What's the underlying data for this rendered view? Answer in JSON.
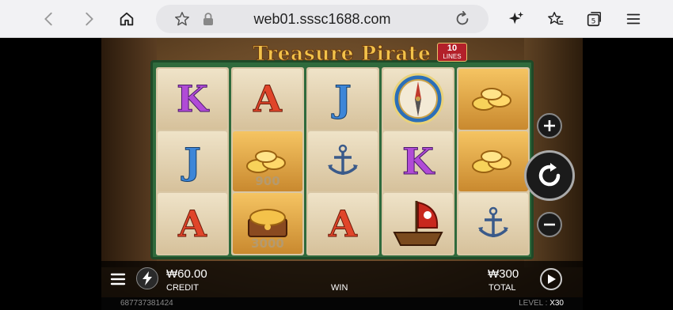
{
  "browser": {
    "url": "web01.sssc1688.com",
    "tab_count": "5"
  },
  "game": {
    "title": "Treasure Pirate",
    "lines_number": "10",
    "lines_label": "LINES",
    "reels": [
      [
        {
          "symbol": "K",
          "type": "letter"
        },
        {
          "symbol": "J",
          "type": "letter"
        },
        {
          "symbol": "A",
          "type": "letter"
        }
      ],
      [
        {
          "symbol": "A",
          "type": "letter"
        },
        {
          "symbol": "gold-coins",
          "type": "gold",
          "value": "900"
        },
        {
          "symbol": "treasure-chest",
          "type": "gold",
          "value": "3000"
        }
      ],
      [
        {
          "symbol": "J",
          "type": "letter"
        },
        {
          "symbol": "anchor",
          "type": "icon"
        },
        {
          "symbol": "A",
          "type": "letter"
        }
      ],
      [
        {
          "symbol": "compass",
          "type": "icon"
        },
        {
          "symbol": "K",
          "type": "letter"
        },
        {
          "symbol": "pirate-ship",
          "type": "icon"
        }
      ],
      [
        {
          "symbol": "gold-coins",
          "type": "gold"
        },
        {
          "symbol": "gold-coins",
          "type": "gold"
        },
        {
          "symbol": "anchor",
          "type": "icon"
        }
      ]
    ],
    "credit_value": "₩60.00",
    "credit_label": "CREDIT",
    "win_label": "WIN",
    "total_value": "₩300",
    "total_label": "TOTAL",
    "session_id": "687737381424",
    "level_label": "LEVEL :",
    "level_value": "X30"
  },
  "colors": {
    "reel_frame": "#2f6a3c",
    "gold": "#f2c24a",
    "lines_badge": "#b3202a"
  }
}
